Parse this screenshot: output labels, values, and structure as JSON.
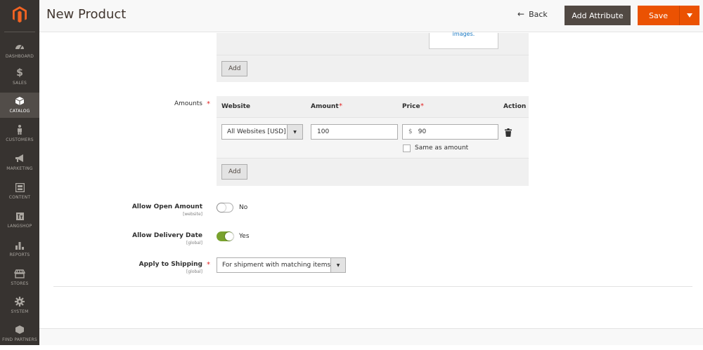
{
  "brand": {
    "accent": "#eb5202",
    "sidebar_bg": "#373330",
    "toggle_on": "#79a22e",
    "link": "#1979c3"
  },
  "sidebar": {
    "logo_icon": "magento-logo-icon",
    "items": [
      {
        "label": "DASHBOARD",
        "icon": "speedometer-icon"
      },
      {
        "label": "SALES",
        "icon": "dollar-icon"
      },
      {
        "label": "CATALOG",
        "icon": "cube-icon",
        "active": true
      },
      {
        "label": "CUSTOMERS",
        "icon": "person-icon"
      },
      {
        "label": "MARKETING",
        "icon": "megaphone-icon"
      },
      {
        "label": "CONTENT",
        "icon": "layout-icon"
      },
      {
        "label": "LANGSHOP",
        "icon": "langshop-icon"
      },
      {
        "label": "REPORTS",
        "icon": "bar-chart-icon"
      },
      {
        "label": "STORES",
        "icon": "storefront-icon"
      },
      {
        "label": "SYSTEM",
        "icon": "gear-icon"
      },
      {
        "label": "FIND PARTNERS",
        "icon": "partners-icon"
      }
    ]
  },
  "header": {
    "title": "New Product",
    "back_label": "Back",
    "add_attribute_label": "Add Attribute",
    "save_label": "Save"
  },
  "images_panel": {
    "image_text": "images.",
    "add_label": "Add"
  },
  "amounts": {
    "label": "Amounts",
    "columns": {
      "website": "Website",
      "amount": "Amount",
      "price": "Price",
      "action": "Action"
    },
    "row": {
      "website": "All Websites [USD]",
      "amount": "100",
      "price_currency": "$",
      "price": "90",
      "same_as_amount": "Same as amount",
      "same_as_amount_checked": false
    },
    "add_label": "Add"
  },
  "allow_open_amount": {
    "label": "Allow Open Amount",
    "scope": "[website]",
    "value": "No",
    "on": false
  },
  "allow_delivery_date": {
    "label": "Allow Delivery Date",
    "scope": "[global]",
    "value": "Yes",
    "on": true
  },
  "apply_to_shipping": {
    "label": "Apply to Shipping",
    "scope": "[global]",
    "value": "For shipment with matching items"
  }
}
